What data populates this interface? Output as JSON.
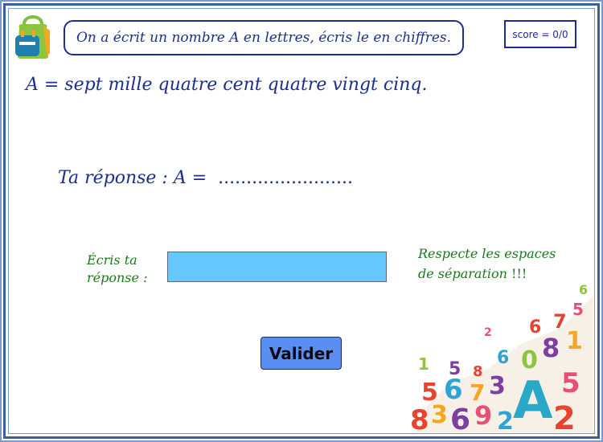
{
  "header": {
    "instruction": "On a écrit un nombre A en lettres, écris le en chiffres.",
    "score": "score = 0/0"
  },
  "statement": "A = sept mille quatre cent quatre vingt cinq.",
  "answer_line": {
    "label": "Ta réponse : A =",
    "dots": "........................"
  },
  "form": {
    "label_line1": "Écris ta",
    "label_line2": "réponse :",
    "input_value": "",
    "hint_line1": "Respecte les espaces",
    "hint_line2": "de séparation",
    "hint_excl": "!!!",
    "validate_label": "Valider"
  },
  "decor": {
    "icons": [
      "backpack-icon",
      "numbers-pile-icon"
    ],
    "colors": {
      "accent": "#1c2f8f",
      "green_text": "#1a7a1a",
      "input_bg": "#66c8ff",
      "button_bg": "#5a8ef2",
      "frame": "#3b5f9c"
    }
  }
}
